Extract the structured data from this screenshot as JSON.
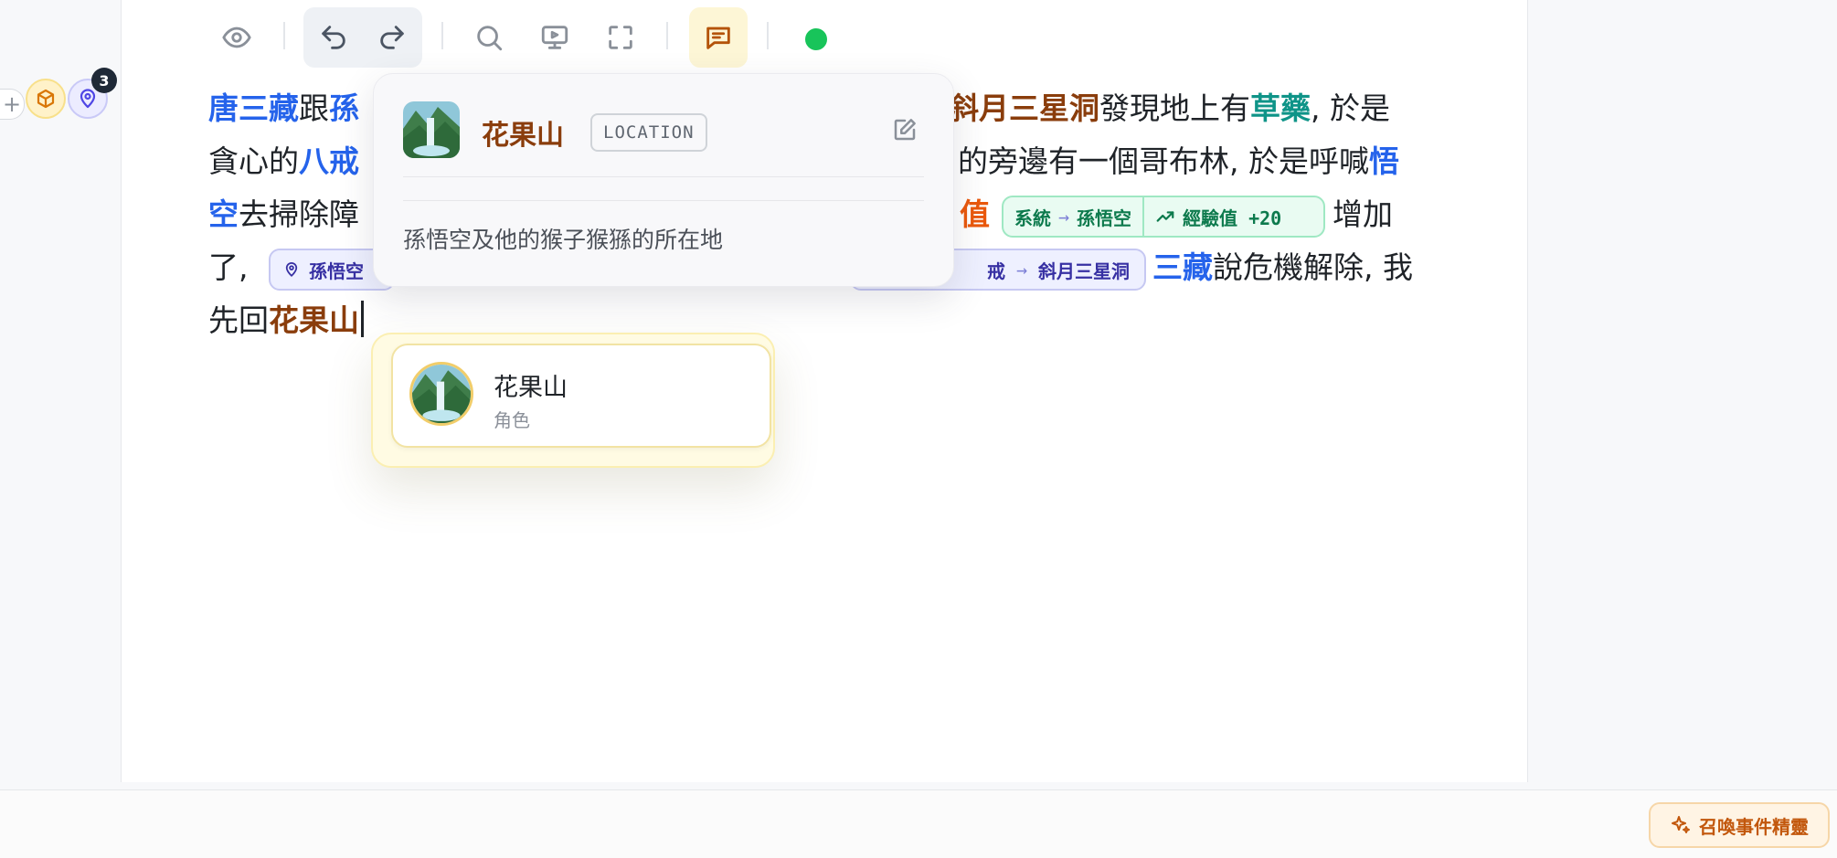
{
  "toolbar": {
    "icons": [
      "eye-icon",
      "undo-icon",
      "redo-icon",
      "search-icon",
      "present-icon",
      "fullscreen-icon",
      "comment-icon"
    ],
    "status_color": "#18c45a"
  },
  "gutter": {
    "add_symbol": "+",
    "badge_count": "3"
  },
  "editor": {
    "lines": [
      [
        {
          "t": "唐三藏",
          "k": "char"
        },
        {
          "t": "跟",
          "k": "plain"
        },
        {
          "t": "孫",
          "k": "char"
        }
      ],
      [
        {
          "t": "貪心的",
          "k": "plain"
        },
        {
          "t": "八戒",
          "k": "char"
        }
      ],
      [
        {
          "t": "空",
          "k": "char"
        },
        {
          "t": "去掃除障",
          "k": "plain"
        }
      ],
      [
        {
          "t": "了, ",
          "k": "plain"
        }
      ],
      [
        {
          "t": "先回",
          "k": "plain"
        },
        {
          "t": "花果山",
          "k": "loc"
        }
      ]
    ],
    "right_segments": [
      [
        {
          "t": "斜月三星洞",
          "k": "loc"
        },
        {
          "t": "發現地上有",
          "k": "plain"
        },
        {
          "t": "草藥",
          "k": "item"
        },
        {
          "t": ", 於是",
          "k": "plain"
        }
      ],
      [
        {
          "t": "的旁邊有一個哥布林, 於是呼喊",
          "k": "plain"
        },
        {
          "t": "悟",
          "k": "char"
        }
      ],
      [
        {
          "t": "值",
          "k": "attr"
        }
      ],
      [
        {
          "t": ", ",
          "k": "plain"
        },
        {
          "t": "三藏",
          "k": "char"
        },
        {
          "t": "說危機解除, 我",
          "k": "plain"
        }
      ]
    ],
    "after_chip_text": "增加",
    "chips": {
      "green": {
        "from": "系統",
        "to": "孫悟空",
        "stat": "經驗值 +20"
      },
      "purple_left": {
        "label": "孫悟空"
      },
      "purple_right": {
        "from": "戒",
        "to": "斜月三星洞"
      }
    }
  },
  "hover_card": {
    "title": "花果山",
    "badge": "LOCATION",
    "description": "孫悟空及他的猴子猴猻的所在地"
  },
  "suggestion": {
    "name": "花果山",
    "type": "角色"
  },
  "summon_button": {
    "label": "召喚事件精靈"
  },
  "colors": {
    "character": "#2563eb",
    "location": "#8a3d0c",
    "item": "#0f9488",
    "attribute": "#ea580c",
    "accent": "#c2570c"
  }
}
